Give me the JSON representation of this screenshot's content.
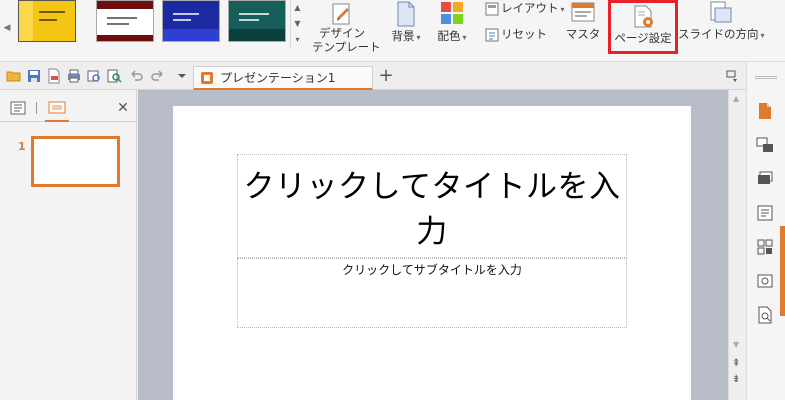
{
  "ribbon": {
    "design_template_line1": "デザイン",
    "design_template_line2": "テンプレート",
    "background": "背景",
    "color_scheme": "配色",
    "layout": "レイアウト",
    "reset": "リセット",
    "master": "マスタ",
    "page_setup": "ページ設定",
    "slide_direction": "スライドの方向"
  },
  "tabs": {
    "doc_title": "プレゼンテーション1"
  },
  "slides_panel": {
    "slide_number": "1"
  },
  "slide": {
    "title_placeholder": "クリックしてタイトルを入力",
    "subtitle_placeholder": "クリックしてサブタイトルを入力"
  },
  "colors": {
    "accent": "#e07a2e",
    "highlight_box": "#e8202a",
    "canvas_bg": "#b9bdc9"
  }
}
